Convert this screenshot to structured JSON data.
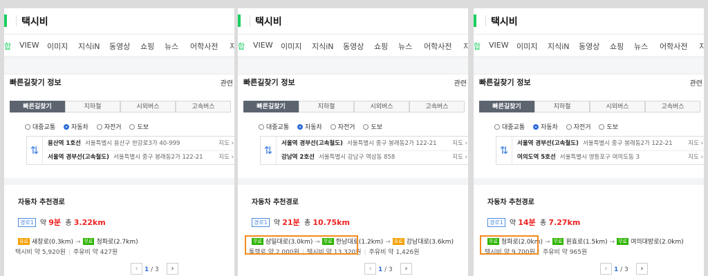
{
  "query": "택시비",
  "nav_tabs": [
    "합",
    "VIEW",
    "이미지",
    "지식iN",
    "동영상",
    "쇼핑",
    "뉴스",
    "어학사전",
    "지"
  ],
  "section_title": "빠른길찾기 정보",
  "related_label": "관련",
  "mode_tabs": [
    "빠른길찾기",
    "지하철",
    "시외버스",
    "고속버스"
  ],
  "radio_options": [
    "대중교통",
    "자동차",
    "자전거",
    "도보"
  ],
  "selected_radio": "자동차",
  "map_label": "지도",
  "recommend_title": "자동차 추천경로",
  "route_badge": "경로1",
  "approx": "약",
  "total": "총",
  "page": {
    "current": "1",
    "total": "/ 3"
  },
  "colors": {
    "brand_green": "#19ce60",
    "highlight_orange": "#f28a1d",
    "time_red": "#ee2222"
  },
  "panels": [
    {
      "from": {
        "name": "용산역 1호선",
        "addr": "서울특별시 용산구 한강로3가 40-999"
      },
      "to": {
        "name": "서울역 경부선(고속철도)",
        "addr": "서울특별시 중구 봉래동2가 122-21"
      },
      "time": "9분",
      "distance": "3.22km",
      "roads": [
        {
          "tag": "유료",
          "tag_color": "orange",
          "name": "새창로(0.3km)"
        },
        {
          "tag": "무료",
          "tag_color": "green",
          "name": "청파로(2.7km)"
        }
      ],
      "costs": [
        {
          "label": "택시비 약 5,920원"
        },
        {
          "label": "주유비 약 427원"
        }
      ]
    },
    {
      "from": {
        "name": "서울역 경부선(고속철도)",
        "addr": "서울특별시 중구 봉래동2가 122-21"
      },
      "to": {
        "name": "강남역 2호선",
        "addr": "서울특별시 강남구 역삼동 858"
      },
      "time": "21분",
      "distance": "10.75km",
      "roads": [
        {
          "tag": "무료",
          "tag_color": "green",
          "name": "삼일대로(3.0km)"
        },
        {
          "tag": "무료",
          "tag_color": "green",
          "name": "한남대로(1.2km)"
        },
        {
          "tag": "유료",
          "tag_color": "orange",
          "name": "강남대로(3.6km)"
        }
      ],
      "costs": [
        {
          "label": "통행료 약 2,000원"
        },
        {
          "label": "택시비 약 13,320원"
        },
        {
          "label": "주유비 약 1,426원"
        }
      ]
    },
    {
      "from": {
        "name": "서울역 경부선(고속철도)",
        "addr": "서울특별시 중구 봉래동2가 122-21"
      },
      "to": {
        "name": "여의도역 5호선",
        "addr": "서울특별시 영등포구 여의도동 3"
      },
      "time": "14분",
      "distance": "7.27km",
      "roads": [
        {
          "tag": "무료",
          "tag_color": "green",
          "name": "청파로(2.0km)"
        },
        {
          "tag": "무료",
          "tag_color": "green",
          "name": "원효로(1.5km)"
        },
        {
          "tag": "무료",
          "tag_color": "green",
          "name": "여의대방로(2.0km)"
        }
      ],
      "costs": [
        {
          "label": "택시비 약 9,700원"
        },
        {
          "label": "주유비 약 965원"
        }
      ]
    }
  ]
}
